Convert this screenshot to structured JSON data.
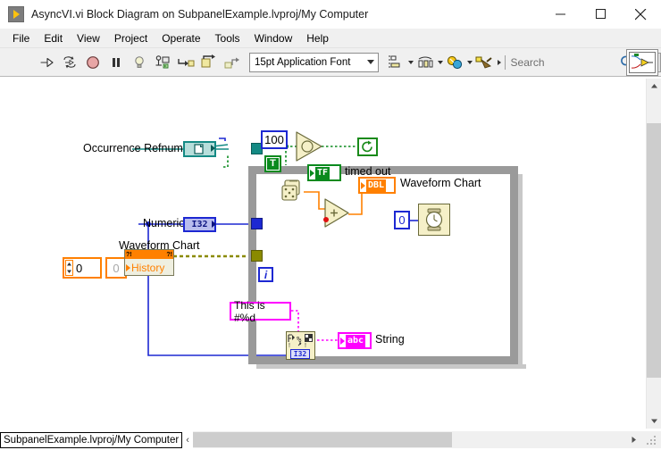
{
  "window": {
    "title": "AsyncVI.vi Block Diagram on SubpanelExample.lvproj/My Computer",
    "app_icon": "labview-run-arrow-icon",
    "minimize": "minimize-icon",
    "maximize": "maximize-icon",
    "close": "close-icon"
  },
  "menubar": {
    "items": [
      {
        "label": "File"
      },
      {
        "label": "Edit"
      },
      {
        "label": "View"
      },
      {
        "label": "Project"
      },
      {
        "label": "Operate"
      },
      {
        "label": "Tools"
      },
      {
        "label": "Window"
      },
      {
        "label": "Help"
      }
    ]
  },
  "toolbar": {
    "run": "run-arrow-icon",
    "run_continuously": "run-continuously-icon",
    "abort": "abort-execution-icon",
    "pause": "pause-icon",
    "highlight_execution": "light-bulb-icon",
    "retain_wire_values": "retain-wire-values-icon",
    "step_into": "step-into-icon",
    "step_over": "step-over-icon",
    "step_out": "step-out-icon",
    "font_label": "15pt Application Font",
    "align_objects": "align-objects-icon",
    "distribute_objects": "distribute-objects-icon",
    "resize_objects": "resize-objects-icon",
    "reorder": "reorder-objects-icon",
    "search_placeholder": "Search",
    "search_value": "",
    "search_icon": "magnifier-icon",
    "help_icon": "question-mark-icon",
    "vi_icon": "vi-connector-pane-icon"
  },
  "statusbar": {
    "path": "SubpanelExample.lvproj/My Computer",
    "expander": "‹"
  },
  "scrollbars": {
    "v_up": "chevron-up-icon",
    "v_down": "chevron-down-icon",
    "h_right": "chevron-right-icon"
  },
  "diagram": {
    "labels": {
      "occurrence_refnum": "Occurrence Refnum",
      "numeric": "Numeric",
      "waveform_chart_ref": "Waveform Chart",
      "timed_out": "timed out",
      "waveform_chart_ind": "Waveform Chart",
      "string": "String"
    },
    "terminals": {
      "occurrence_refnum_type": "",
      "numeric_type": "I32",
      "timed_out_type": "TF",
      "waveform_chart_type": "DBL",
      "string_type": "abc",
      "format_int_type": "I32"
    },
    "constants": {
      "timeout_ms": "100",
      "boolean_true": "T",
      "history_index": "0",
      "history_value": "0",
      "wait_ms": "0",
      "format_string": "This is #%d",
      "iteration": "i"
    },
    "nodes": {
      "wait_on_occurrence": "wait-on-occurrence-icon",
      "set_occurrence": "set-occurrence-icon",
      "random_number": "random-number-dice-icon",
      "add": "+",
      "wait_ms_timer": "wait-ms-timer-icon",
      "format_into_string": "format-into-string-icon",
      "property_node_history": "History",
      "property_node_class": "property-node-icon"
    }
  },
  "colors": {
    "wire_refnum": "#148a84",
    "wire_boolean": "#0a8a1e",
    "wire_numeric_int": "#1d28d2",
    "wire_numeric_dbl": "#ff8000",
    "wire_string": "#ff00ff",
    "wire_reference": "#8a8a00",
    "structure_gray": "#9a9a9a",
    "node_yellow": "#f5f0c8"
  }
}
